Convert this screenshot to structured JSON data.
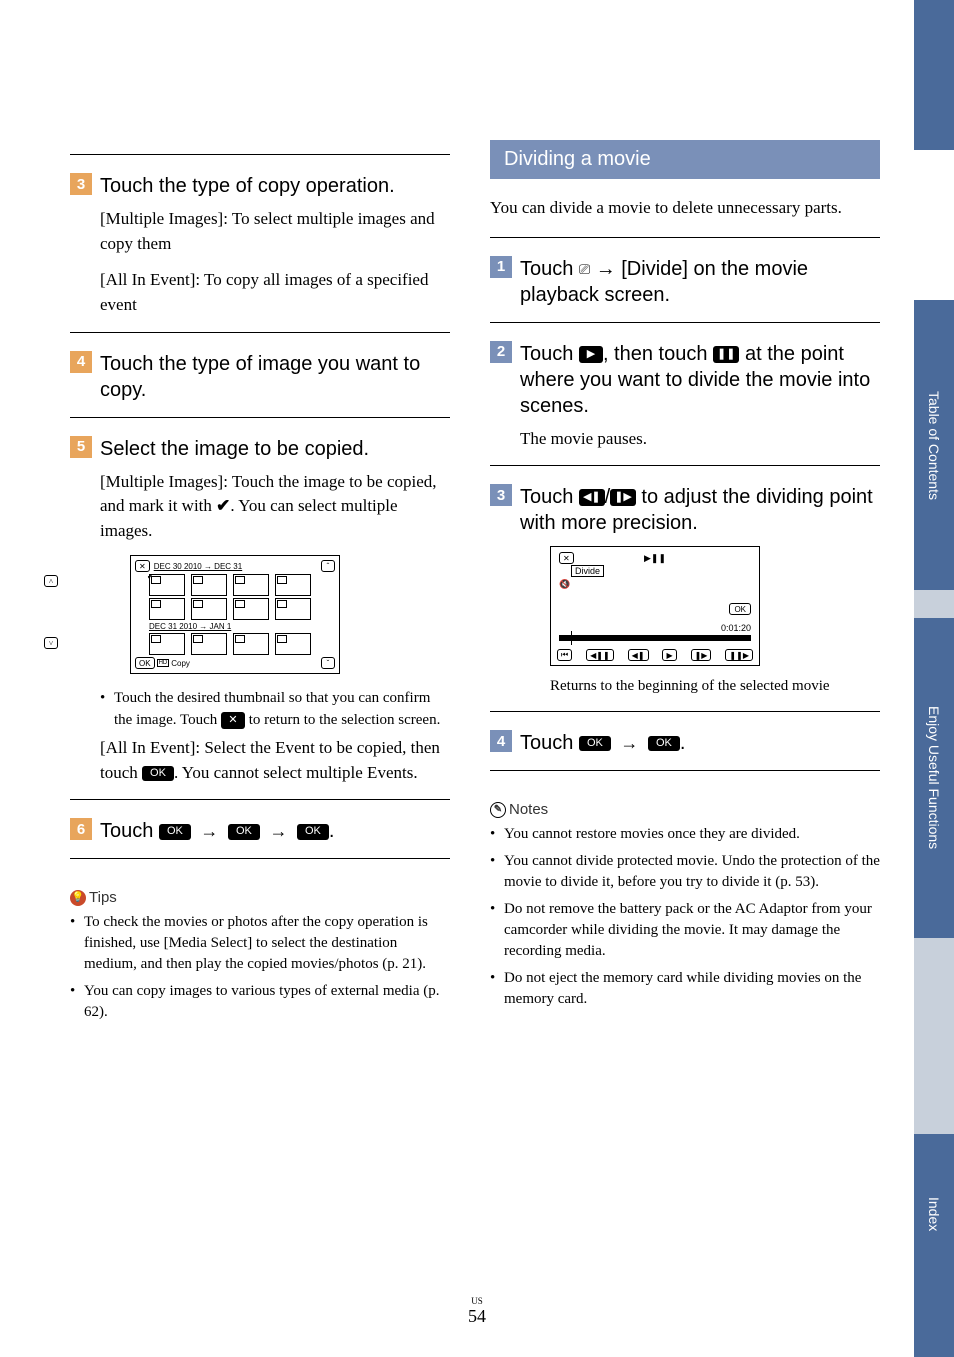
{
  "footer": {
    "region": "US",
    "page": "54"
  },
  "sideTabs": {
    "toc": "Table of Contents",
    "useful": "Enjoy Useful Functions",
    "index": "Index"
  },
  "left": {
    "step3": {
      "title": "Touch the type of copy operation.",
      "body_a": "[Multiple Images]: To select multiple images and copy them",
      "body_b": "[All In Event]: To copy all images of a specified event"
    },
    "step4": {
      "title": "Touch the type of image you want to copy."
    },
    "step5": {
      "title": "Select the image to be copied.",
      "body": "[Multiple Images]: Touch the image to be copied, and mark it with ",
      "body_tail": ". You can select multiple images.",
      "bullet": "Touch the desired thumbnail so that you can confirm the image. Touch ",
      "bullet_tail": " to return to the selection screen.",
      "body2_a": "[All In Event]: Select the Event to be copied, then touch ",
      "body2_b": ". You cannot select multiple Events."
    },
    "screenshot": {
      "date1": "DEC 30 2010 → DEC 31",
      "date2": "DEC 31 2010 → JAN 1",
      "copy": "Copy",
      "ok": "OK",
      "hd": "HD"
    },
    "step6": {
      "pre": "Touch ",
      "ok": "OK",
      "post": "."
    },
    "tips": {
      "header": "Tips",
      "items": [
        "To check the movies or photos after the copy operation is finished, use [Media Select] to select the destination medium, and then play the copied movies/photos (p. 21).",
        "You can copy images to various types of external media (p. 62)."
      ]
    }
  },
  "right": {
    "banner": "Dividing a movie",
    "intro": "You can divide a movie to delete unnecessary parts.",
    "step1": {
      "pre": "Touch ",
      "post": " → [Divide] on the movie playback screen."
    },
    "step2": {
      "pre": "Touch ",
      "mid": ", then touch ",
      "post": " at the point where you want to divide the movie into scenes.",
      "body": "The movie pauses."
    },
    "step3": {
      "pre": "Touch ",
      "mid": "/",
      "post": " to adjust the dividing point with more precision."
    },
    "divide_ss": {
      "divide": "Divide",
      "ok": "OK",
      "time": "0:01:20"
    },
    "caption": "Returns to the beginning of the selected movie",
    "step4": {
      "pre": "Touch ",
      "ok": "OK",
      "post": "."
    },
    "notes": {
      "header": "Notes",
      "items": [
        "You cannot restore movies once they are divided.",
        "You cannot divide protected movie. Undo the protection of the movie to divide it, before you try to divide it (p. 53).",
        "Do not remove the battery pack or the AC Adaptor from your camcorder while dividing the movie. It may damage the recording media.",
        "Do not eject the memory card while dividing movies on the memory card."
      ]
    }
  }
}
